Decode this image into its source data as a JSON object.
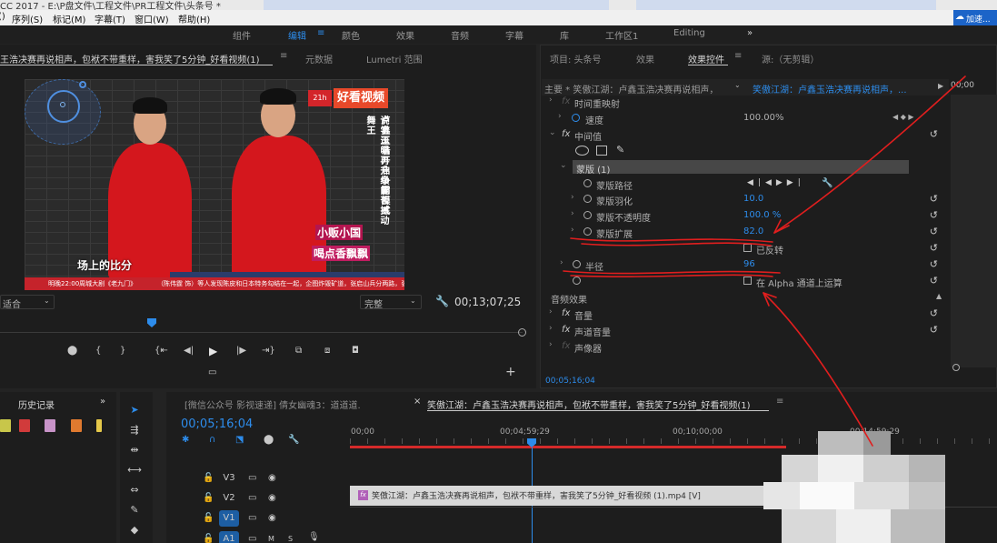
{
  "titlebar": {
    "title": "CC 2017 - E:\\P盘文件\\工程文件\\PR工程文件\\头条号 *"
  },
  "menubar": {
    "items": [
      "()",
      "序列(S)",
      "标记(M)",
      "字幕(T)",
      "窗口(W)",
      "帮助(H)"
    ],
    "badge": "加速..."
  },
  "workspaces": {
    "items": [
      "组件",
      "编辑",
      "颜色",
      "效果",
      "音频",
      "字幕",
      "库",
      "工作区1",
      "Editing"
    ],
    "active": "编辑",
    "more": "»"
  },
  "program_monitor": {
    "tabs": [
      "王浩决赛再说相声，包袱不带重样，害我笑了5分钟_好看视频(1)",
      "元数据",
      "Lumetri 范围"
    ],
    "tab_menu": "≡",
    "fit_label": "适合",
    "quality_label": "完整",
    "timecode": "00;13;07;25",
    "video": {
      "logo_badge": "好看视频",
      "logo_channel": "21h",
      "vertical_text_1": "卢鑫玉浩开启争霸模式",
      "vertical_text_2": "说学逗唱再升级能否撼动舞王",
      "pink_caption_1": "小贩小国",
      "pink_caption_2": "喝点香飘飘",
      "subtitle": "场上的比分",
      "ticker_left": "明晚22:00周城大剧《老九门》",
      "ticker_right": "（陈伟霆 饰）等人发现陈皮和日本特务勾结在一起，企图炸毁矿道，张启山兵分两路，张启山率队伏击，陈启..."
    }
  },
  "effect_controls": {
    "tabs": [
      "项目: 头条号",
      "效果",
      "效果控件",
      "源:（无剪辑）"
    ],
    "tab_menu": "≡",
    "master_label": "主要 * 笑傲江湖：卢鑫玉浩决赛再说相声，",
    "sequence_label": "笑傲江湖：卢鑫玉浩决赛再说相声，...",
    "mini_timecode": "00;00",
    "rows": {
      "time_remap": "时间重映射",
      "speed_label": "速度",
      "speed_value": "100.00%",
      "median": "中间值",
      "mask": "蒙版 (1)",
      "mask_path": "蒙版路径",
      "mask_feather": "蒙版羽化",
      "mask_feather_value": "10.0",
      "mask_opacity": "蒙版不透明度",
      "mask_opacity_value": "100.0 %",
      "mask_expansion": "蒙版扩展",
      "mask_expansion_value": "82.0",
      "inverted": "已反转",
      "radius": "半径",
      "radius_value": "96",
      "alpha_op": "在 Alpha 通道上运算",
      "audio_effects": "音频效果",
      "volume": "音量",
      "channel_volume": "声道音量",
      "panner": "声像器"
    },
    "footer_timecode": "00;05;16;04",
    "fx_label": "fx"
  },
  "history": {
    "tab": "历史记录",
    "more": "»",
    "swatch_colors": [
      "#c8c64a",
      "#d13b3b",
      "#c893c8",
      "#e07a2f",
      "#e5c84a"
    ]
  },
  "timeline": {
    "tabs": [
      "[微信公众号 影视速递] 倩女幽魂3：道道道.",
      "笑傲江湖：卢鑫玉浩决赛再说相声，包袱不带重样，害我笑了5分钟_好看视频(1)"
    ],
    "close": "×",
    "tab_menu": "≡",
    "timecode": "00;05;16;04",
    "ruler": [
      "00;00",
      "00;04;59;29",
      "00;10;00;00",
      "00;14;59;29"
    ],
    "tracks": [
      "V3",
      "V2",
      "V1",
      "A1"
    ],
    "clip_label": "笑傲江湖：卢鑫玉浩决赛再说相声，包袱不带重样，害我笑了5分钟_好看视频 (1).mp4 [V]",
    "clip_fx": "fx"
  },
  "colors": {
    "accent": "#2d8ceb",
    "annotation": "#e01e1e"
  }
}
